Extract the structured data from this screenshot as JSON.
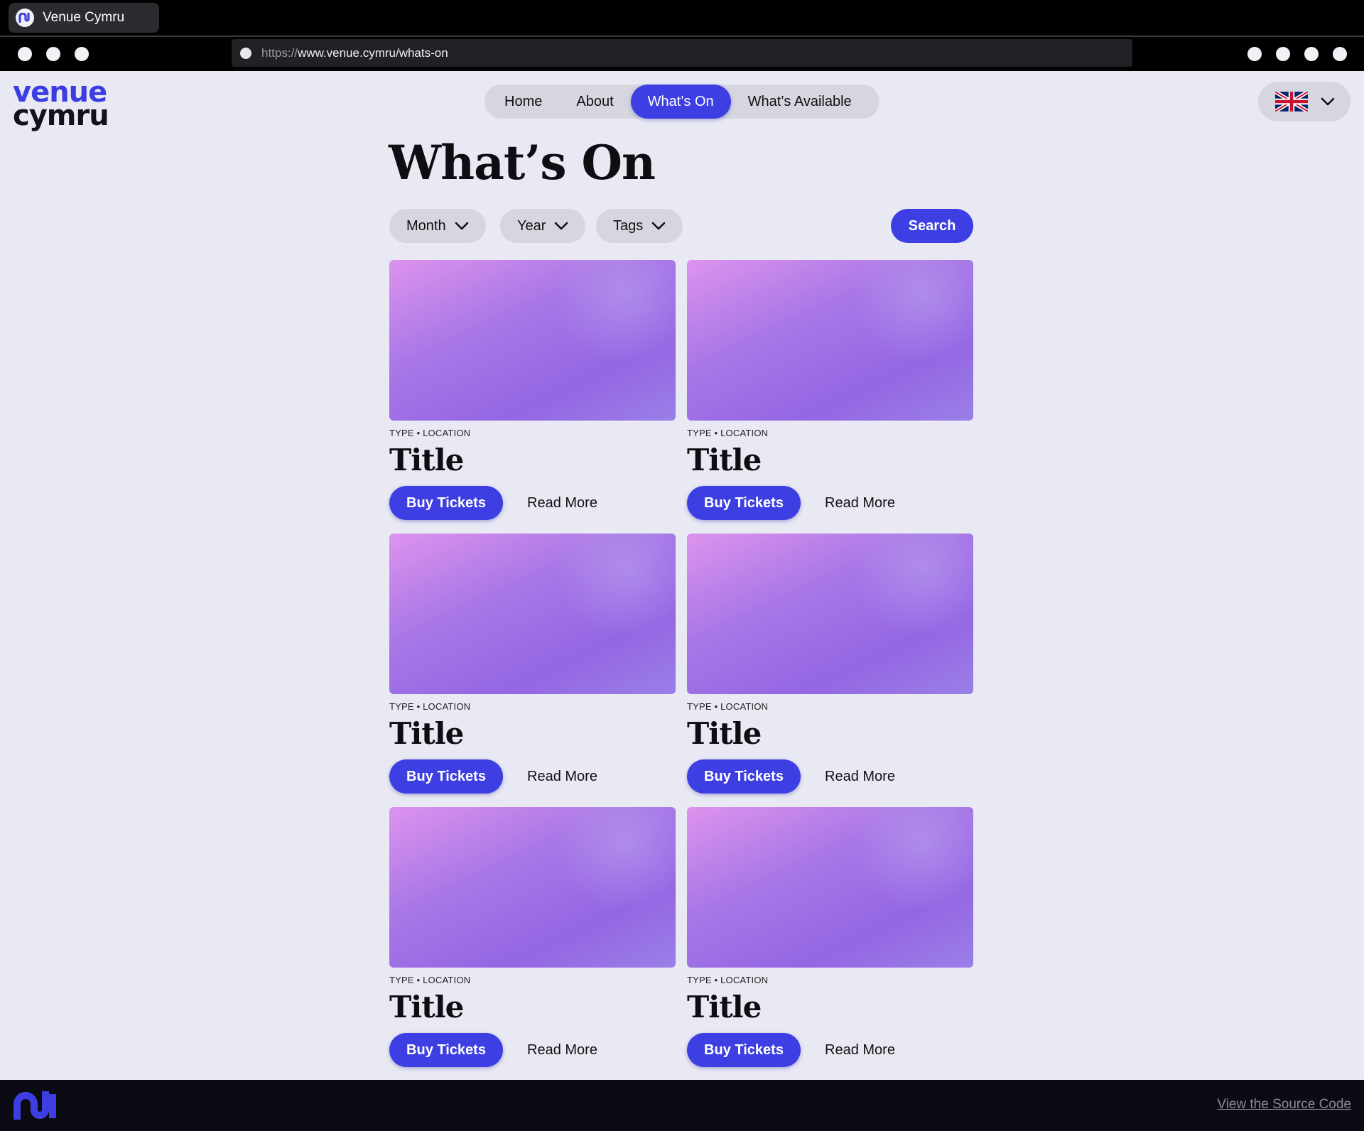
{
  "browser": {
    "tab_title": "Venue Cymru",
    "url_protocol": "https://",
    "url_rest": "www.venue.cymru/whats-on"
  },
  "logo": {
    "top": "venue",
    "bottom": "cymru"
  },
  "nav": {
    "items": [
      {
        "label": "Home"
      },
      {
        "label": "About"
      },
      {
        "label": "What’s On"
      },
      {
        "label": "What’s Available"
      }
    ],
    "active_index": 2
  },
  "language": {
    "icon": "uk-flag-icon"
  },
  "page": {
    "title": "What’s On"
  },
  "filters": {
    "month": "Month",
    "year": "Year",
    "tags": "Tags",
    "search": "Search"
  },
  "cards": [
    {
      "meta": "TYPE • LOCATION",
      "title": "Title",
      "buy": "Buy Tickets",
      "more": "Read More"
    },
    {
      "meta": "TYPE • LOCATION",
      "title": "Title",
      "buy": "Buy Tickets",
      "more": "Read More"
    },
    {
      "meta": "TYPE • LOCATION",
      "title": "Title",
      "buy": "Buy Tickets",
      "more": "Read More"
    },
    {
      "meta": "TYPE • LOCATION",
      "title": "Title",
      "buy": "Buy Tickets",
      "more": "Read More"
    },
    {
      "meta": "TYPE • LOCATION",
      "title": "Title",
      "buy": "Buy Tickets",
      "more": "Read More"
    },
    {
      "meta": "TYPE • LOCATION",
      "title": "Title",
      "buy": "Buy Tickets",
      "more": "Read More"
    }
  ],
  "footer": {
    "link": "View the Source Code"
  },
  "colors": {
    "accent": "#3d3fe3",
    "background": "#e9e9f4",
    "pill": "#d6d6e0",
    "footer": "#0b0b14"
  }
}
